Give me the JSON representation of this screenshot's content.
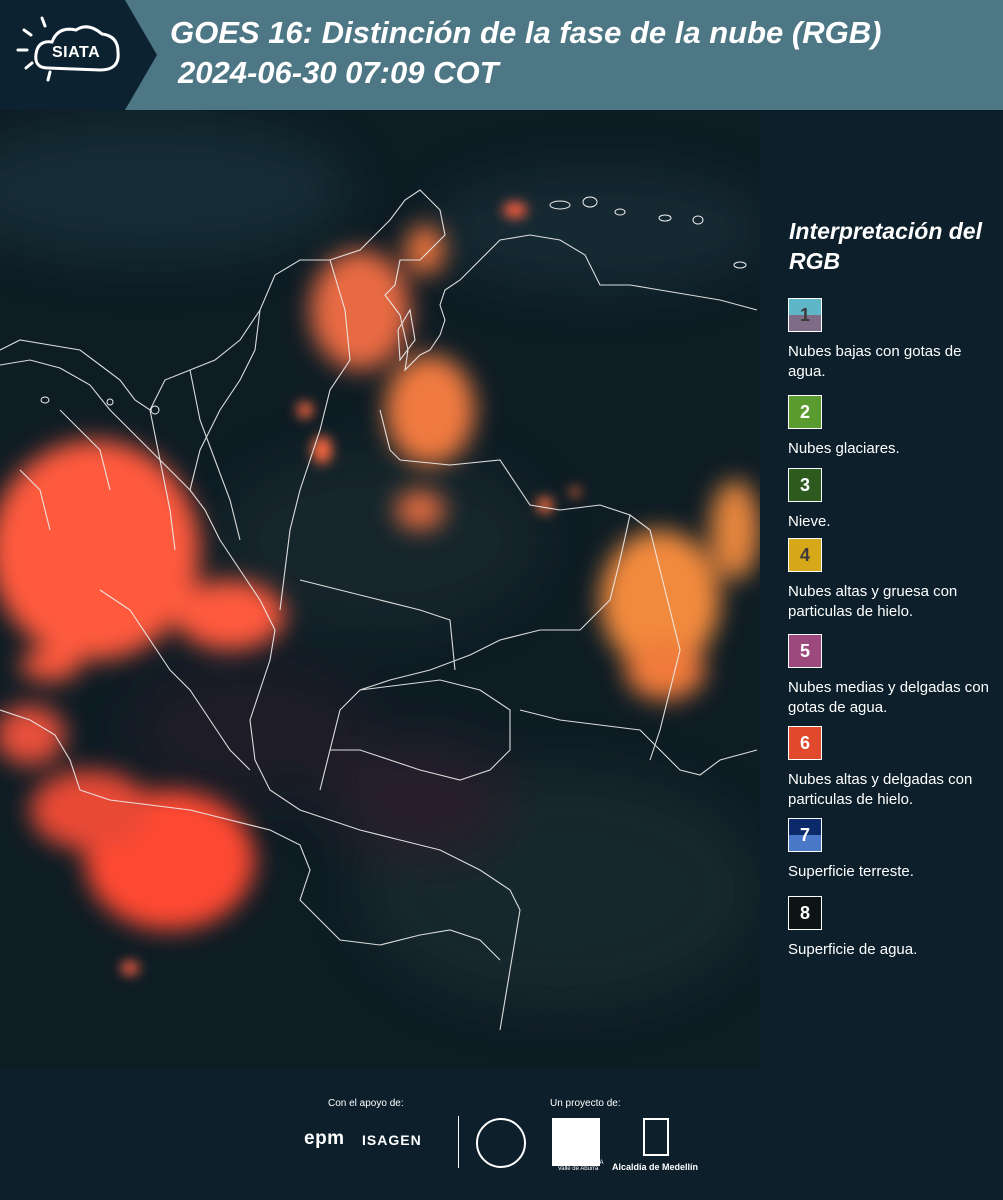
{
  "header": {
    "logo_text": "SIATA",
    "title": "GOES 16: Distinción de la fase de la nube (RGB)",
    "subtitle": "2024-06-30 07:09 COT"
  },
  "legend": {
    "title": "Interpretación del RGB",
    "items": [
      {
        "number": "1",
        "label": "Nubes bajas con gotas de agua.",
        "color_top": "#5fb6c6",
        "color_bottom": "#7e6b85"
      },
      {
        "number": "2",
        "label": "Nubes glaciares.",
        "color": "#5a9a2e"
      },
      {
        "number": "3",
        "label": "Nieve.",
        "color": "#2d5a1e"
      },
      {
        "number": "4",
        "label": "Nubes altas y gruesa con particulas de hielo.",
        "color": "#d7a819"
      },
      {
        "number": "5",
        "label": "Nubes medias y delgadas con gotas de agua.",
        "color": "#9c4a7e"
      },
      {
        "number": "6",
        "label": "Nubes altas y delgadas con particulas de hielo.",
        "color": "#e0492b"
      },
      {
        "number": "7",
        "label": "Superficie terreste.",
        "color_top": "#0c2a6a",
        "color_bottom": "#4a78c8"
      },
      {
        "number": "8",
        "label": "Superficie de agua.",
        "color": "#0c1414"
      }
    ]
  },
  "footer": {
    "support_label": "Con el apoyo de:",
    "project_label": "Un proyecto de:",
    "sponsor_1": "epm",
    "sponsor_2": "ISAGEN",
    "partner_1_caption": "METROPOLITANA Valle de Aburrá",
    "partner_2": "Alcaldía de Medellín"
  },
  "colors": {
    "header_bg": "#4e7785",
    "panel_bg": "#0c1f2b",
    "cloud_high": "#ff5a3c",
    "cloud_mid": "#f08a3a"
  }
}
